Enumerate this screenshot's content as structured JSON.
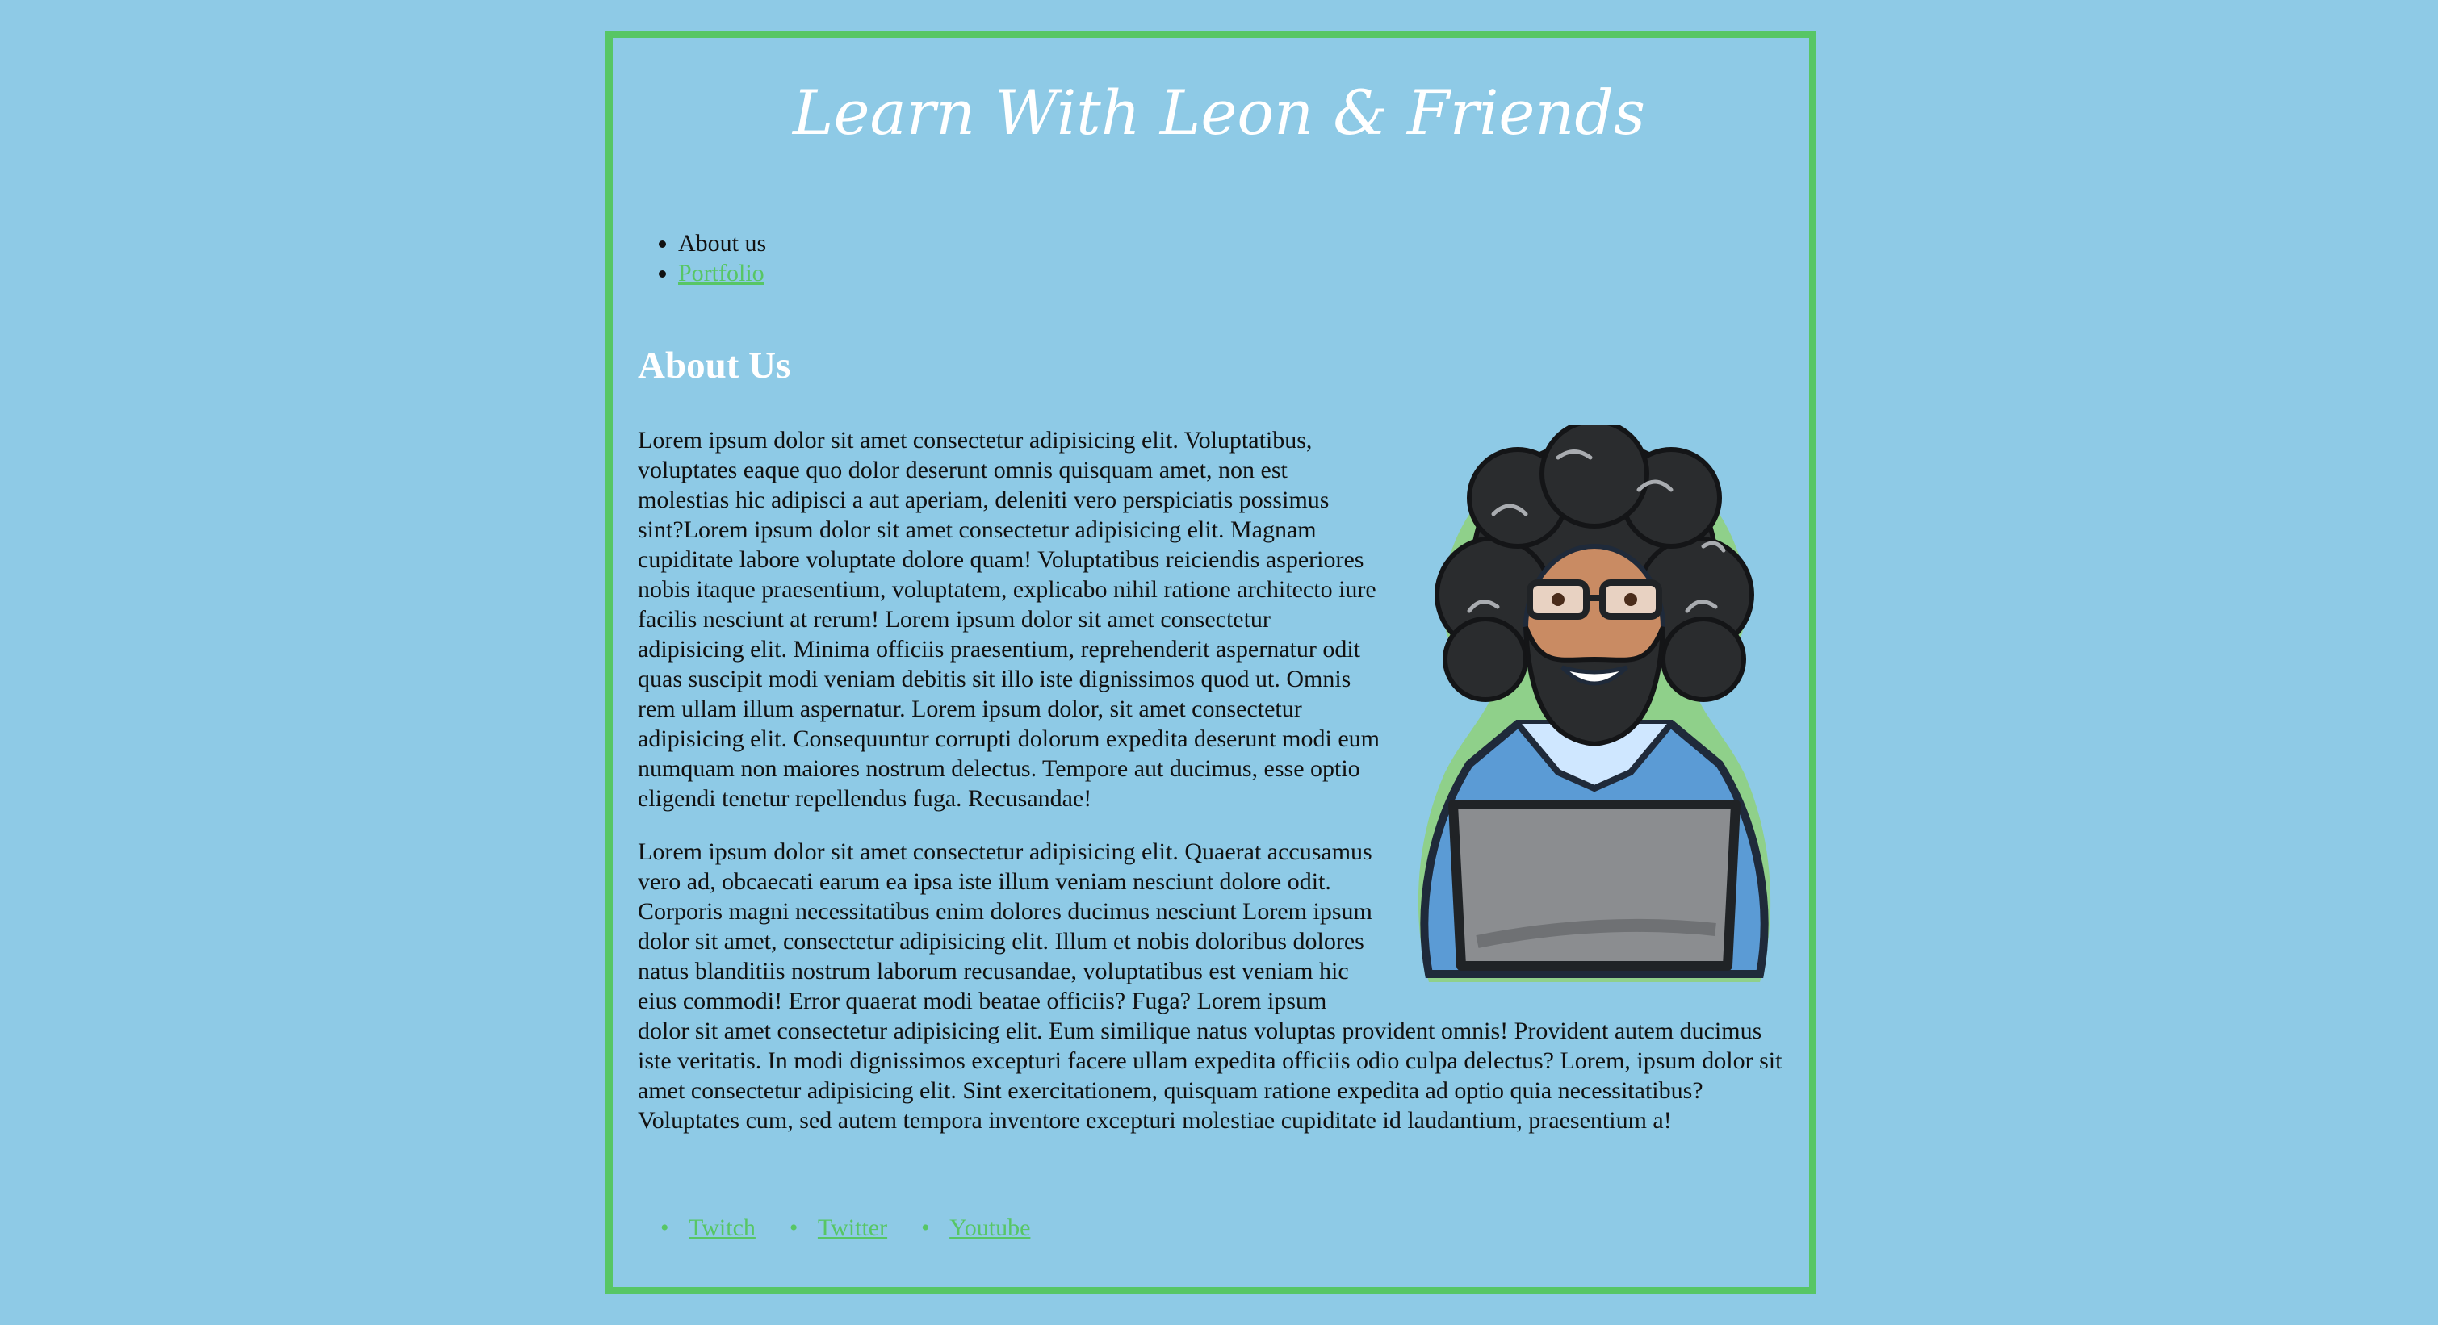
{
  "header": {
    "title": "Learn With Leon & Friends"
  },
  "nav": {
    "items": [
      {
        "label": "About us"
      },
      {
        "label": "Portfolio"
      }
    ]
  },
  "about": {
    "heading": "About Us",
    "paragraph_1": "Lorem ipsum dolor sit amet consectetur adipisicing elit. Voluptatibus, voluptates eaque quo dolor deserunt omnis quisquam amet, non est molestias hic adipisci a aut aperiam, deleniti vero perspiciatis possimus sint?Lorem ipsum dolor sit amet consectetur adipisicing elit. Magnam cupiditate labore voluptate dolore quam! Voluptatibus reiciendis asperiores nobis itaque praesentium, voluptatem, explicabo nihil ratione architecto iure facilis nesciunt at rerum! Lorem ipsum dolor sit amet consectetur adipisicing elit. Minima officiis praesentium, reprehenderit aspernatur odit quas suscipit modi veniam debitis sit illo iste dignissimos quod ut. Omnis rem ullam illum aspernatur. Lorem ipsum dolor, sit amet consectetur adipisicing elit. Consequuntur corrupti dolorum expedita deserunt modi eum numquam non maiores nostrum delectus. Tempore aut ducimus, esse optio eligendi tenetur repellendus fuga. Recusandae!",
    "paragraph_2": "Lorem ipsum dolor sit amet consectetur adipisicing elit. Quaerat accusamus vero ad, obcaecati earum ea ipsa iste illum veniam nesciunt dolore odit. Corporis magni necessitatibus enim dolores ducimus nesciunt Lorem ipsum dolor sit amet, consectetur adipisicing elit. Illum et nobis doloribus dolores natus blanditiis nostrum laborum recusandae, voluptatibus est veniam hic eius commodi! Error quaerat modi beatae officiis? Fuga? Lorem ipsum dolor sit amet consectetur adipisicing elit. Eum similique natus voluptas provident omnis! Provident autem ducimus iste veritatis. In modi dignissimos excepturi facere ullam expedita officiis odio culpa delectus? Lorem, ipsum dolor sit amet consectetur adipisicing elit. Sint exercitationem, quisquam ratione expedita ad optio quia necessitatibus? Voluptates cum, sed autem tempora inventore excepturi molestiae cupiditate id laudantium, praesentium a!"
  },
  "footer": {
    "links": [
      {
        "label": "Twitch"
      },
      {
        "label": "Twitter"
      },
      {
        "label": "Youtube"
      }
    ]
  },
  "colors": {
    "background": "#8ecae6",
    "border": "#57c665",
    "link": "#57c665",
    "heading": "#ffffff",
    "text": "#111111"
  },
  "icons": {
    "avatar": "bearded-developer-with-laptop-avatar"
  }
}
